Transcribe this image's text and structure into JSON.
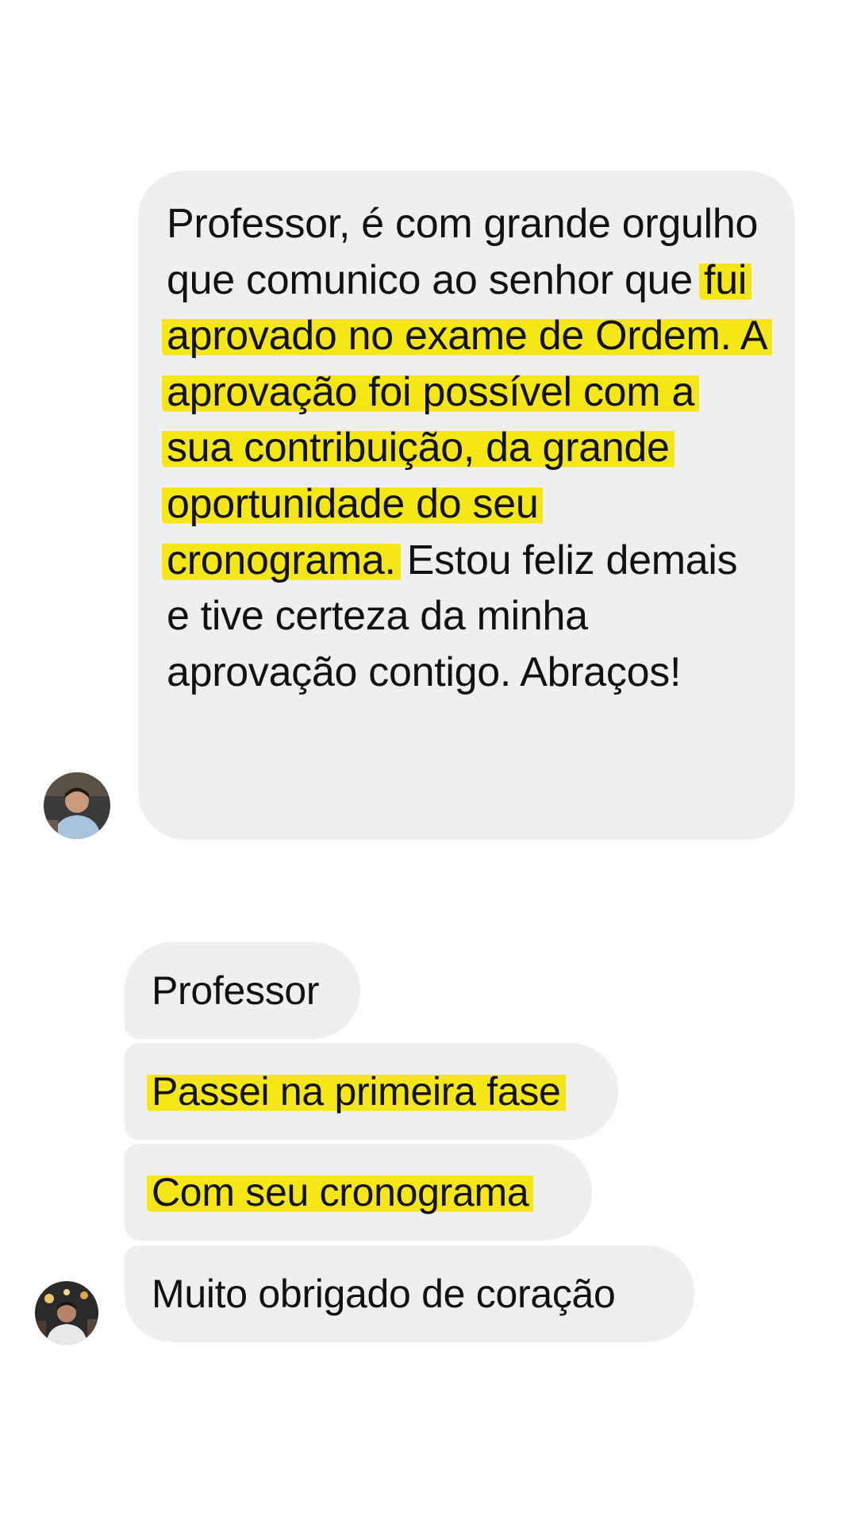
{
  "messages": [
    {
      "type": "long",
      "segments": [
        {
          "text": "Professor, é com grande orgulho que comunico ao senhor que ",
          "highlight": false
        },
        {
          "text": "fui aprovado no exame de Ordem. A aprovação foi possível com a sua contribuição, da grande oportunidade do seu cronograma.",
          "highlight": true
        },
        {
          "text": " Estou feliz demais e tive certeza da minha aprovação contigo. Abraços!",
          "highlight": false
        }
      ],
      "avatar": "user-avatar-icon"
    },
    {
      "type": "short",
      "text": "Professor",
      "highlight": false
    },
    {
      "type": "short",
      "text": "Passei na primeira fase",
      "highlight": true
    },
    {
      "type": "short",
      "text": "Com seu cronograma",
      "highlight": true
    },
    {
      "type": "short",
      "text": "Muito obrigado de coração",
      "highlight": false,
      "avatar": "user-avatar-icon"
    }
  ],
  "colors": {
    "bubble": "#efefef",
    "highlight": "#f5e615",
    "text": "#111111",
    "background": "#ffffff"
  }
}
